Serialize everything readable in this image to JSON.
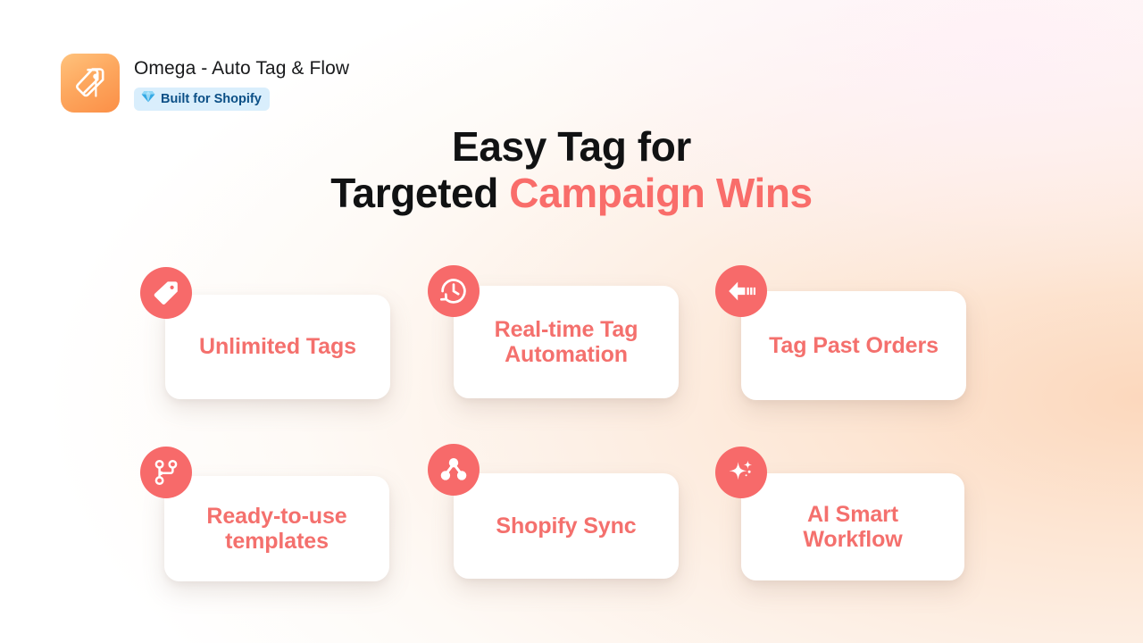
{
  "header": {
    "app_icon_name": "tag-pin-icon",
    "app_title": "Omega - Auto Tag & Flow",
    "badge": {
      "label": "Built for Shopify",
      "icon": "diamond-gem-icon",
      "bg_color": "#d9eefc",
      "text_color": "#0b4f86"
    }
  },
  "headline": {
    "line1": "Easy Tag for",
    "line2_plain": "Targeted ",
    "line2_accent": "Campaign Wins",
    "accent_color": "#f96d6a",
    "base_color": "#111213"
  },
  "theme": {
    "coral": "#f76a6a",
    "card_title_color": "#f4706d",
    "card_bg": "#ffffff",
    "page_bg_start": "#ffffff",
    "page_bg_end": "#fbdcc4"
  },
  "features": [
    {
      "title": "Unlimited Tags",
      "icon": "tag-icon",
      "lines": 1
    },
    {
      "title": "Real-time Tag Automation",
      "icon": "clock-history-icon",
      "lines": 2
    },
    {
      "title": "Tag Past Orders",
      "icon": "arrow-left-dashes-icon",
      "lines": 1
    },
    {
      "title": "Ready-to-use templates",
      "icon": "git-branch-icon",
      "lines": 2
    },
    {
      "title": "Shopify Sync",
      "icon": "share-nodes-icon",
      "lines": 1
    },
    {
      "title": "AI Smart Workflow",
      "icon": "sparkle-icon",
      "lines": 2
    }
  ]
}
